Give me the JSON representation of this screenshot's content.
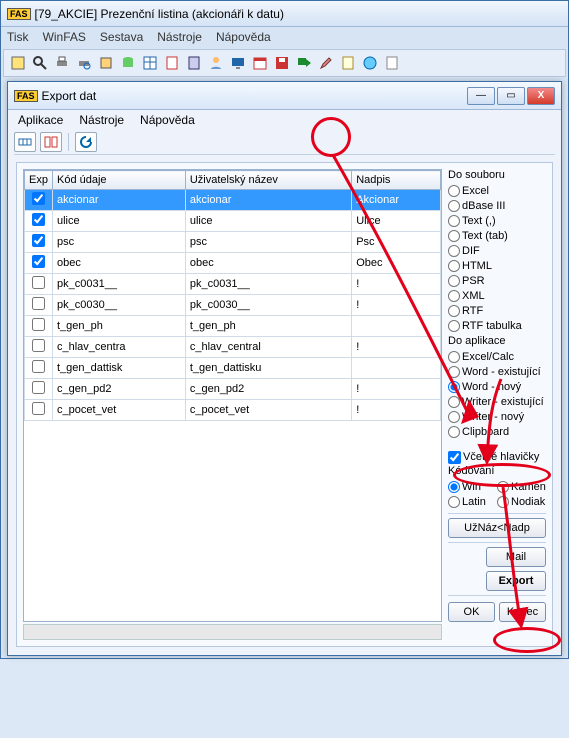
{
  "outer": {
    "title": "[79_AKCIE] Prezenční listina (akcionáři k datu)",
    "menu": [
      "Tisk",
      "WinFAS",
      "Sestava",
      "Nástroje",
      "Nápověda"
    ]
  },
  "inner": {
    "title": "Export dat",
    "menu": [
      "Aplikace",
      "Nástroje",
      "Nápověda"
    ],
    "winbtns": {
      "min": "—",
      "max": "▭",
      "close": "X"
    }
  },
  "grid": {
    "headers": {
      "exp": "Exp",
      "kod": "Kód údaje",
      "uziv": "Uživatelský název",
      "nadpis": "Nadpis"
    },
    "rows": [
      {
        "chk": true,
        "sel": true,
        "kod": "akcionar",
        "uziv": "akcionar",
        "nadpis": "Akcionar"
      },
      {
        "chk": true,
        "sel": false,
        "kod": "ulice",
        "uziv": "ulice",
        "nadpis": "Ulice"
      },
      {
        "chk": true,
        "sel": false,
        "kod": "psc",
        "uziv": "psc",
        "nadpis": "Psc"
      },
      {
        "chk": true,
        "sel": false,
        "kod": "obec",
        "uziv": "obec",
        "nadpis": "Obec"
      },
      {
        "chk": false,
        "sel": false,
        "kod": "pk_c0031__",
        "uziv": "pk_c0031__",
        "nadpis": "!"
      },
      {
        "chk": false,
        "sel": false,
        "kod": "pk_c0030__",
        "uziv": "pk_c0030__",
        "nadpis": "!"
      },
      {
        "chk": false,
        "sel": false,
        "kod": "t_gen_ph",
        "uziv": "t_gen_ph",
        "nadpis": ""
      },
      {
        "chk": false,
        "sel": false,
        "kod": "c_hlav_centra",
        "uziv": "c_hlav_central",
        "nadpis": "!"
      },
      {
        "chk": false,
        "sel": false,
        "kod": "t_gen_dattisk",
        "uziv": "t_gen_dattisku",
        "nadpis": ""
      },
      {
        "chk": false,
        "sel": false,
        "kod": "c_gen_pd2",
        "uziv": "c_gen_pd2",
        "nadpis": "!"
      },
      {
        "chk": false,
        "sel": false,
        "kod": "c_pocet_vet",
        "uziv": "c_pocet_vet",
        "nadpis": "!"
      }
    ]
  },
  "right": {
    "group1_label": "Do souboru",
    "file_formats": [
      "Excel",
      "dBase III",
      "Text (,)",
      "Text (tab)",
      "DIF",
      "HTML",
      "PSR",
      "XML",
      "RTF",
      "RTF tabulka"
    ],
    "group2_label": "Do aplikace",
    "app_formats": [
      "Excel/Calc",
      "Word - existující",
      "Word - nový",
      "Writer - existující",
      "Writer - nový",
      "Clipboard"
    ],
    "app_selected_index": 2,
    "include_header_label": "Včetně hlavičky",
    "include_header_checked": true,
    "encoding_label": "Kódování",
    "encodings": [
      "Win",
      "Kamen",
      "Latin",
      "Nodiakr"
    ],
    "encoding_selected": 0,
    "btn_uznaz": "UžNáz<Nadp",
    "btn_mail": "Mail",
    "btn_export": "Export",
    "btn_ok": "OK",
    "btn_konec": "Konec"
  }
}
